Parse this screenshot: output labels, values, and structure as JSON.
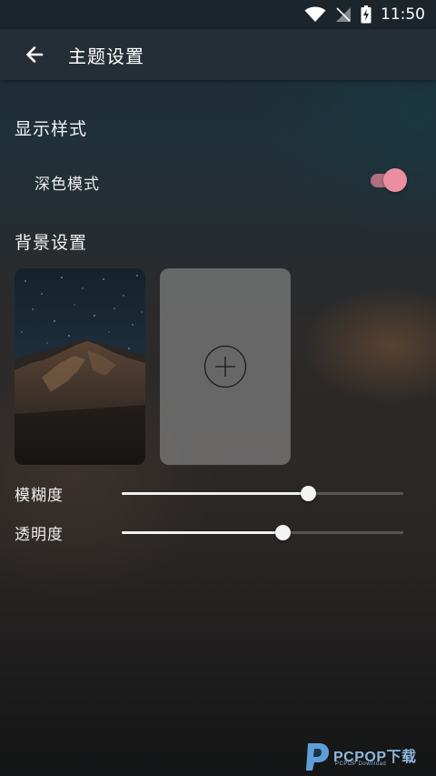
{
  "status_bar": {
    "time": "11:50",
    "wifi_icon": "wifi-icon",
    "signal_icon": "no-signal-icon",
    "battery_icon": "battery-charging-icon"
  },
  "app_bar": {
    "title": "主题设置",
    "back_icon": "arrow-left-icon"
  },
  "display_section": {
    "title": "显示样式",
    "dark_mode": {
      "label": "深色模式",
      "enabled": true,
      "accent_color": "#ec8ea2"
    }
  },
  "background_section": {
    "title": "背景设置",
    "add_icon": "plus-circle-icon"
  },
  "sliders": {
    "blur": {
      "label": "模糊度",
      "value": 0.66
    },
    "opacity": {
      "label": "透明度",
      "value": 0.57
    }
  },
  "watermark": {
    "brand": "PCPOP下载",
    "sub": "PCPOP Download"
  }
}
